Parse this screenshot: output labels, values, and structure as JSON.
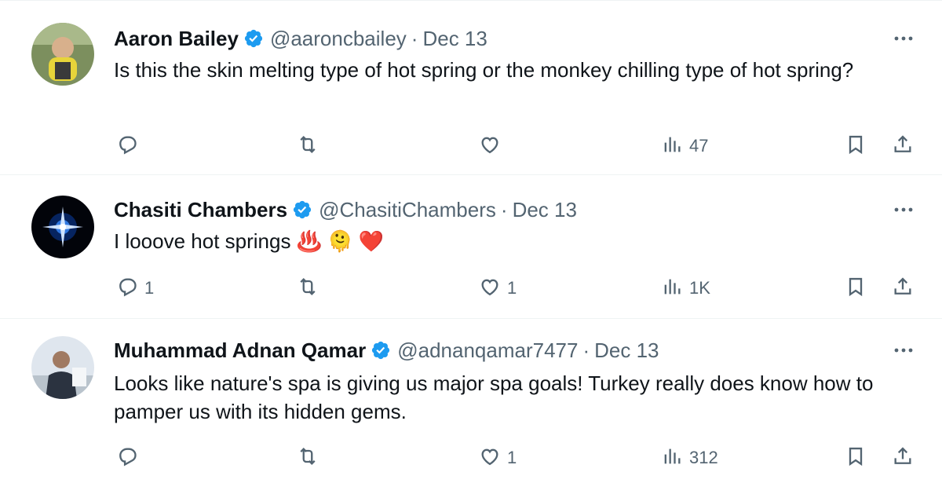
{
  "tweets": [
    {
      "name": "Aaron Bailey",
      "handle": "@aaroncbailey",
      "separator": "·",
      "date": "Dec 13",
      "text": "Is this the skin melting type of hot spring or the monkey chilling type of hot spring?",
      "reply_count": "",
      "retweet_count": "",
      "like_count": "",
      "view_count": "47"
    },
    {
      "name": "Chasiti Chambers",
      "handle": "@ChasitiChambers",
      "separator": "·",
      "date": "Dec 13",
      "text": "I looove hot springs",
      "emojis": [
        "♨️",
        "🫠",
        "❤️"
      ],
      "reply_count": "1",
      "retweet_count": "",
      "like_count": "1",
      "view_count": "1K"
    },
    {
      "name": "Muhammad Adnan Qamar",
      "handle": "@adnanqamar7477",
      "separator": "·",
      "date": "Dec 13",
      "text": "Looks like nature's spa is giving us major spa goals! Turkey really does know how to pamper us with its hidden gems.",
      "reply_count": "",
      "retweet_count": "",
      "like_count": "1",
      "view_count": "312"
    }
  ],
  "colors": {
    "verified": "#1d9bf0",
    "secondary_text": "#536471",
    "primary_text": "#0f1419",
    "like_red": "#e0245e"
  },
  "icons": [
    "reply-icon",
    "retweet-icon",
    "like-icon",
    "views-icon",
    "bookmark-icon",
    "share-icon",
    "more-icon",
    "verified-badge-icon"
  ]
}
